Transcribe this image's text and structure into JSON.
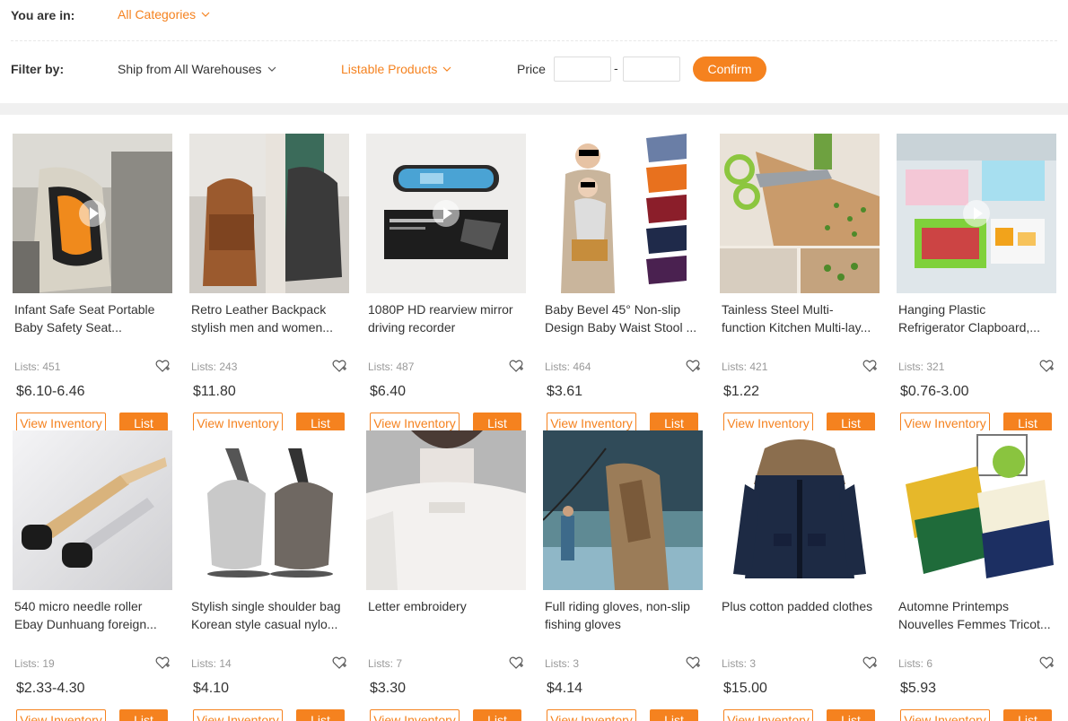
{
  "header": {
    "you_are_in_label": "You are in:",
    "category": "All Categories",
    "filter_by_label": "Filter by:",
    "ship_from": "Ship from All Warehouses",
    "listable": "Listable Products",
    "price_label": "Price",
    "price_min_value": "",
    "price_max_value": "",
    "price_dash": "-",
    "confirm_label": "Confirm"
  },
  "colors": {
    "accent": "#f5821f"
  },
  "products": [
    {
      "title_1": "Infant Safe Seat Portable",
      "title_2": "Baby Safety Seat...",
      "lists": "Lists: 451",
      "price": "$6.10-6.46",
      "view_inventory": "View Inventory",
      "list": "List",
      "video": true,
      "icon": "car-seat-image"
    },
    {
      "title_1": "Retro Leather Backpack",
      "title_2": "stylish men and women...",
      "lists": "Lists: 243",
      "price": "$11.80",
      "view_inventory": "View Inventory",
      "list": "List",
      "video": false,
      "icon": "backpack-image"
    },
    {
      "title_1": "1080P HD rearview mirror",
      "title_2": "driving recorder",
      "lists": "Lists: 487",
      "price": "$6.40",
      "view_inventory": "View Inventory",
      "list": "List",
      "video": true,
      "icon": "rearview-mirror-image"
    },
    {
      "title_1": "Baby Bevel 45° Non-slip",
      "title_2": "Design Baby Waist Stool ...",
      "lists": "Lists: 464",
      "price": "$3.61",
      "view_inventory": "View Inventory",
      "list": "List",
      "video": false,
      "icon": "baby-carrier-image"
    },
    {
      "title_1": "Tainless Steel Multi-",
      "title_2": "function Kitchen Multi-lay...",
      "lists": "Lists: 421",
      "price": "$1.22",
      "view_inventory": "View Inventory",
      "list": "List",
      "video": false,
      "icon": "herb-scissors-image"
    },
    {
      "title_1": "Hanging Plastic",
      "title_2": "Refrigerator Clapboard,...",
      "lists": "Lists: 321",
      "price": "$0.76-3.00",
      "view_inventory": "View Inventory",
      "list": "List",
      "video": true,
      "icon": "fridge-drawer-image"
    },
    {
      "title_1": "540 micro needle roller",
      "title_2": "Ebay Dunhuang foreign...",
      "lists": "Lists: 19",
      "price": "$2.33-4.30",
      "view_inventory": "View Inventory",
      "list": "List",
      "video": false,
      "icon": "needle-roller-image"
    },
    {
      "title_1": "Stylish single shoulder bag",
      "title_2": "Korean style casual nylo...",
      "lists": "Lists: 14",
      "price": "$4.10",
      "view_inventory": "View Inventory",
      "list": "List",
      "video": false,
      "icon": "shoulder-bag-image"
    },
    {
      "title_1": "Letter embroidery",
      "title_2": "",
      "lists": "Lists: 7",
      "price": "$3.30",
      "view_inventory": "View Inventory",
      "list": "List",
      "video": false,
      "icon": "sweater-image"
    },
    {
      "title_1": "Full riding gloves, non-slip",
      "title_2": "fishing gloves",
      "lists": "Lists: 3",
      "price": "$4.14",
      "view_inventory": "View Inventory",
      "list": "List",
      "video": false,
      "icon": "fishing-image"
    },
    {
      "title_1": "Plus cotton padded clothes",
      "title_2": "",
      "lists": "Lists: 3",
      "price": "$15.00",
      "view_inventory": "View Inventory",
      "list": "List",
      "video": false,
      "icon": "parka-image"
    },
    {
      "title_1": "Automne Printemps",
      "title_2": "Nouvelles Femmes Tricot...",
      "lists": "Lists: 6",
      "price": "$5.93",
      "view_inventory": "View Inventory",
      "list": "List",
      "video": false,
      "icon": "folded-sweaters-image"
    }
  ]
}
